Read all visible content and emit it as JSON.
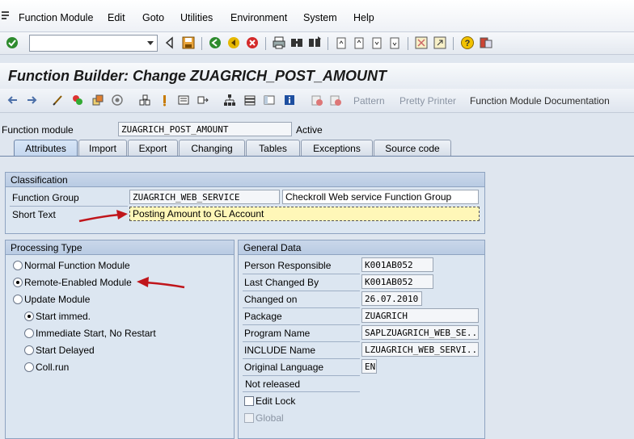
{
  "menu": {
    "items": [
      "Function Module",
      "Edit",
      "Goto",
      "Utilities",
      "Environment",
      "System",
      "Help"
    ]
  },
  "toolbar": {
    "command_value": "",
    "icons": [
      "enter-icon",
      "back-icon",
      "save-icon",
      "back-nav-icon",
      "exit-icon",
      "cancel-icon",
      "print-icon",
      "find-icon",
      "find-next-icon",
      "first-page-icon",
      "prev-page-icon",
      "next-page-icon",
      "last-page-icon",
      "new-session-icon",
      "shortcut-icon",
      "help-icon",
      "layout-icon"
    ]
  },
  "title": "Function Builder: Change ZUAGRICH_POST_AMOUNT",
  "app_toolbar": {
    "pattern": "Pattern",
    "pretty_printer": "Pretty Printer",
    "documentation": "Function Module Documentation"
  },
  "header": {
    "fm_label": "Function module",
    "fm_value": "ZUAGRICH_POST_AMOUNT",
    "status": "Active"
  },
  "tabs": [
    "Attributes",
    "Import",
    "Export",
    "Changing",
    "Tables",
    "Exceptions",
    "Source code"
  ],
  "classification": {
    "title": "Classification",
    "fg_label": "Function Group",
    "fg_value": "ZUAGRICH_WEB_SERVICE",
    "fg_desc": "Checkroll Web service Function Group",
    "short_label": "Short Text",
    "short_value": "Posting Amount to GL Account"
  },
  "processing": {
    "title": "Processing Type",
    "normal": "Normal Function Module",
    "remote": "Remote-Enabled Module",
    "update": "Update Module",
    "start_immed": "Start immed.",
    "immediate_no_restart": "Immediate Start, No Restart",
    "start_delayed": "Start Delayed",
    "coll_run": "Coll.run"
  },
  "general": {
    "title": "General Data",
    "person_label": "Person Responsible",
    "person_value": "K001AB052",
    "changed_by_label": "Last Changed By",
    "changed_by_value": "K001AB052",
    "changed_on_label": "Changed on",
    "changed_on_value": "26.07.2010",
    "package_label": "Package",
    "package_value": "ZUAGRICH",
    "program_label": "Program Name",
    "program_value": "SAPLZUAGRICH_WEB_SE...",
    "include_label": "INCLUDE Name",
    "include_value": "LZUAGRICH_WEB_SERVI...",
    "language_label": "Original Language",
    "language_value": "EN",
    "not_released": "Not released",
    "edit_lock": "Edit Lock",
    "global": "Global"
  },
  "colors": {
    "background": "#dfe6ef",
    "short_text_highlight": "#fff7b8",
    "annotation_arrow": "#c0151b"
  }
}
